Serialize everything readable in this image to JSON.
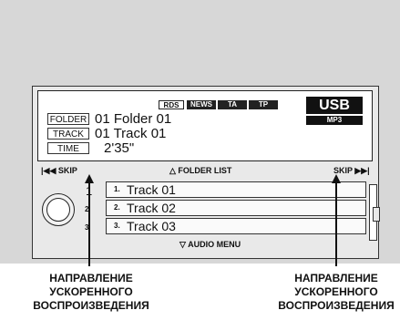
{
  "display": {
    "indicators": [
      "RDS",
      "NEWS",
      "TA",
      "TP"
    ],
    "source": "USB",
    "format": "MP3",
    "folder_label": "FOLDER",
    "folder_value": "01 Folder 01",
    "track_label": "TRACK",
    "track_value": "01 Track 01",
    "time_label": "TIME",
    "time_value": "2'35\""
  },
  "controls": {
    "skip_left": "SKIP",
    "folder_list": "FOLDER LIST",
    "skip_right": "SKIP",
    "audio_menu": "AUDIO MENU"
  },
  "presets": [
    "1",
    "2",
    "3"
  ],
  "tracks": [
    {
      "num": "1.",
      "name": "Track 01"
    },
    {
      "num": "2.",
      "name": "Track 02"
    },
    {
      "num": "3.",
      "name": "Track 03"
    }
  ],
  "captions": {
    "left": [
      "НАПРАВЛЕНИЕ",
      "УСКОРЕННОГО",
      "ВОСПРОИЗВЕДЕНИЯ"
    ],
    "right": [
      "НАПРАВЛЕНИЕ",
      "УСКОРЕННОГО",
      "ВОСПРОИЗВЕДЕНИЯ"
    ]
  },
  "colors": {
    "background_gray": "#d7d7d7",
    "unit_body": "#e9e9e9",
    "indicator_dark": "#222222"
  }
}
